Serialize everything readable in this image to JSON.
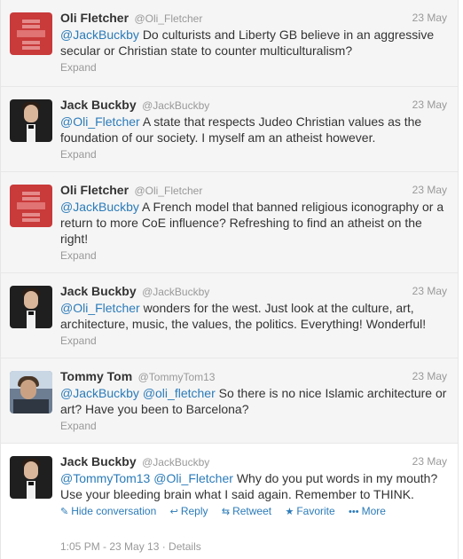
{
  "tweets": [
    {
      "name": "Oli Fletcher",
      "handle": "@Oli_Fletcher",
      "date": "23 May",
      "mentions": [
        "@JackBuckby"
      ],
      "body": "Do culturists and Liberty GB believe in an aggressive secular or Christian state to counter multiculturalism?",
      "expand": "Expand"
    },
    {
      "name": "Jack Buckby",
      "handle": "@JackBuckby",
      "date": "23 May",
      "mentions": [
        "@Oli_Fletcher"
      ],
      "body": "A state that respects Judeo Christian values as the foundation of our society. I myself am an atheist however.",
      "expand": "Expand"
    },
    {
      "name": "Oli Fletcher",
      "handle": "@Oli_Fletcher",
      "date": "23 May",
      "mentions": [
        "@JackBuckby"
      ],
      "body": "A French model that banned religious iconography or a return to more CoE influence? Refreshing to find an atheist on the right!",
      "expand": "Expand"
    },
    {
      "name": "Jack Buckby",
      "handle": "@JackBuckby",
      "date": "23 May",
      "mentions": [
        "@Oli_Fletcher"
      ],
      "body": "wonders for the west. Just look at the culture, art, architecture, music, the values, the politics. Everything! Wonderful!",
      "expand": "Expand"
    },
    {
      "name": "Tommy Tom",
      "handle": "@TommyTom13",
      "date": "23 May",
      "mentions": [
        "@JackBuckby",
        "@oli_fletcher"
      ],
      "body": "So there is no nice Islamic architecture or art? Have you been to Barcelona?",
      "expand": "Expand"
    },
    {
      "name": "Jack Buckby",
      "handle": "@JackBuckby",
      "date": "23 May",
      "mentions": [
        "@TommyTom13",
        "@Oli_Fletcher"
      ],
      "body": "Why do you put words in my mouth? Use your bleeding brain what I said again. Remember to THINK.",
      "actions": {
        "hide": "Hide conversation",
        "reply": "Reply",
        "retweet": "Retweet",
        "favorite": "Favorite",
        "more": "More"
      },
      "meta": "1:05 PM - 23 May 13 · Details"
    }
  ],
  "colors": {
    "link": "#2b7bb9",
    "muted": "#999999",
    "text": "#333333",
    "row_bg": "#f5f5f5",
    "oli_avatar": "#c93a3a"
  },
  "icons": {
    "hide": "speech-bubble-icon",
    "reply": "reply-arrow-icon",
    "retweet": "retweet-icon",
    "favorite": "star-icon",
    "more": "more-dots-icon"
  }
}
